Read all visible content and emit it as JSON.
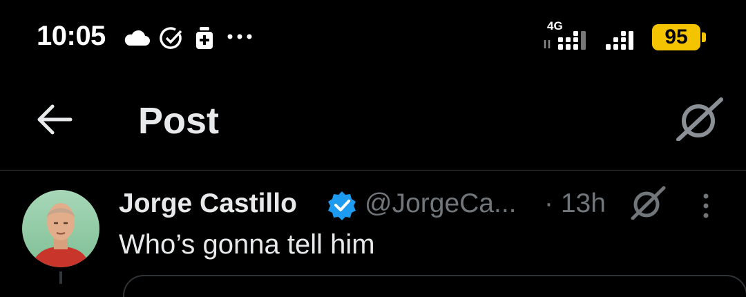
{
  "status_bar": {
    "time": "10:05",
    "network_label": "4G",
    "battery": "95",
    "icons": [
      "cloud-icon",
      "check-circle-icon",
      "medkit-icon",
      "more-dots-icon",
      "signal-icon",
      "signal-icon"
    ],
    "battery_color": "#f5c400"
  },
  "header": {
    "back_icon": "arrow-left-icon",
    "title": "Post",
    "grok_icon": "grok-icon"
  },
  "post": {
    "author_name": "Jorge Castillo",
    "verified": true,
    "handle": "@JorgeCa...",
    "time_ago": "· 13h",
    "text": "Who’s gonna tell him",
    "verified_color": "#1d9bf0",
    "secondary_text_color": "#71767b"
  }
}
